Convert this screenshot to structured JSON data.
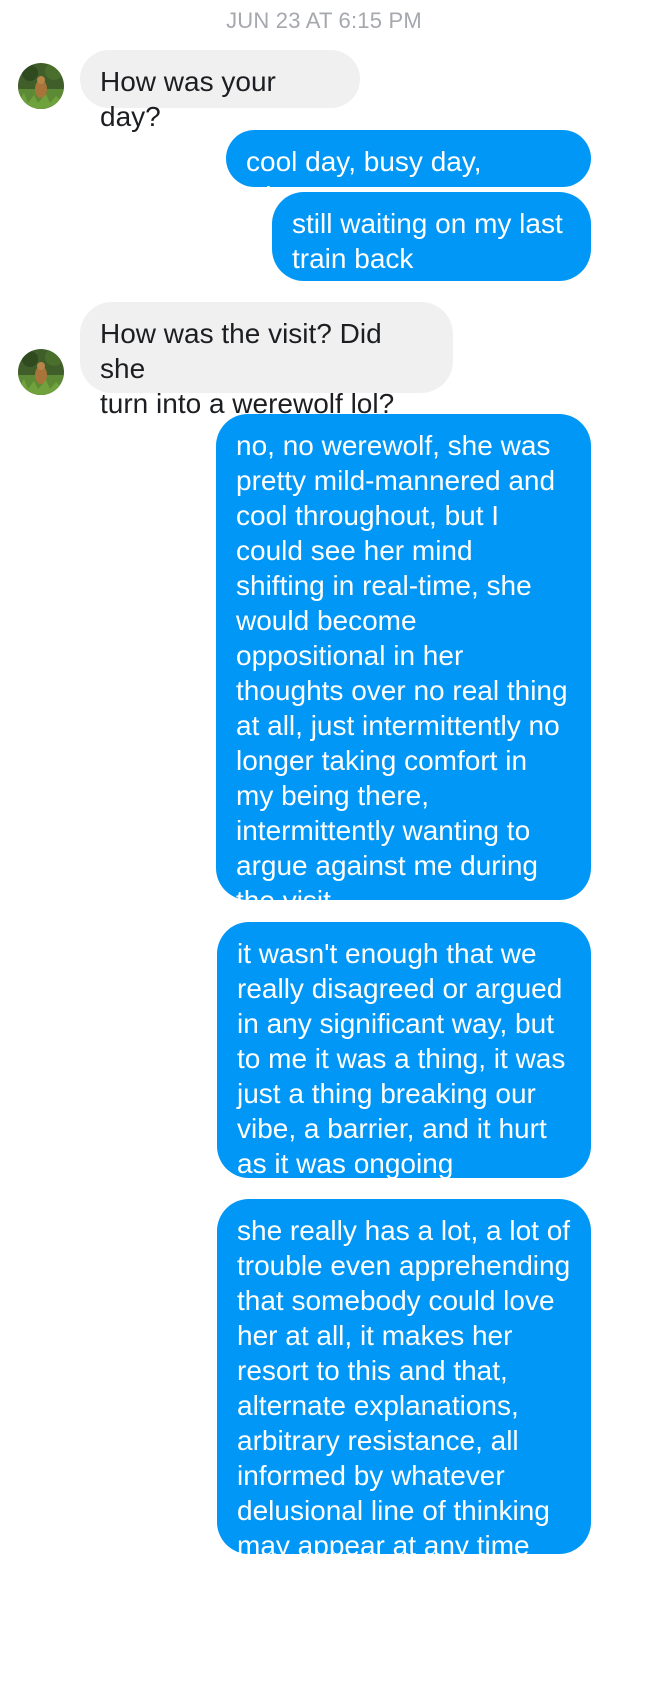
{
  "thread": {
    "timestamp": "JUN 23 AT 6:15 PM"
  },
  "colors": {
    "outgoing_bubble": "#0197f6",
    "incoming_bubble": "#f0f0f0",
    "timestamp_text": "#a5a8ad"
  },
  "messages": [
    {
      "sender": "them",
      "text": "How was your day?"
    },
    {
      "sender": "me",
      "text": "cool day, busy day, y'know"
    },
    {
      "sender": "me",
      "text": "still waiting on my last\ntrain back"
    },
    {
      "sender": "them",
      "text": "How was the visit? Did she\nturn into a werewolf lol?"
    },
    {
      "sender": "me",
      "text": "no, no werewolf, she was\npretty mild-mannered and\ncool throughout, but I\ncould see her mind\nshifting in real-time, she\nwould become\noppositional in her\nthoughts over no real thing\nat all, just intermittently no\nlonger taking comfort in\nmy being there,\nintermittently wanting to\nargue against me during\nthe visit"
    },
    {
      "sender": "me",
      "text": "it wasn't enough that we\nreally disagreed or argued\nin any significant way, but\nto me it was a thing, it was\njust a thing breaking our\nvibe, a barrier, and it hurt\nas it was ongoing"
    },
    {
      "sender": "me",
      "text": "she really has a lot, a lot of\ntrouble even apprehending\nthat somebody could love\nher at all, it makes her\nresort to this and that,\nalternate explanations,\narbitrary resistance, all\ninformed by whatever\ndelusional line of thinking\nmay appear at any time"
    }
  ]
}
